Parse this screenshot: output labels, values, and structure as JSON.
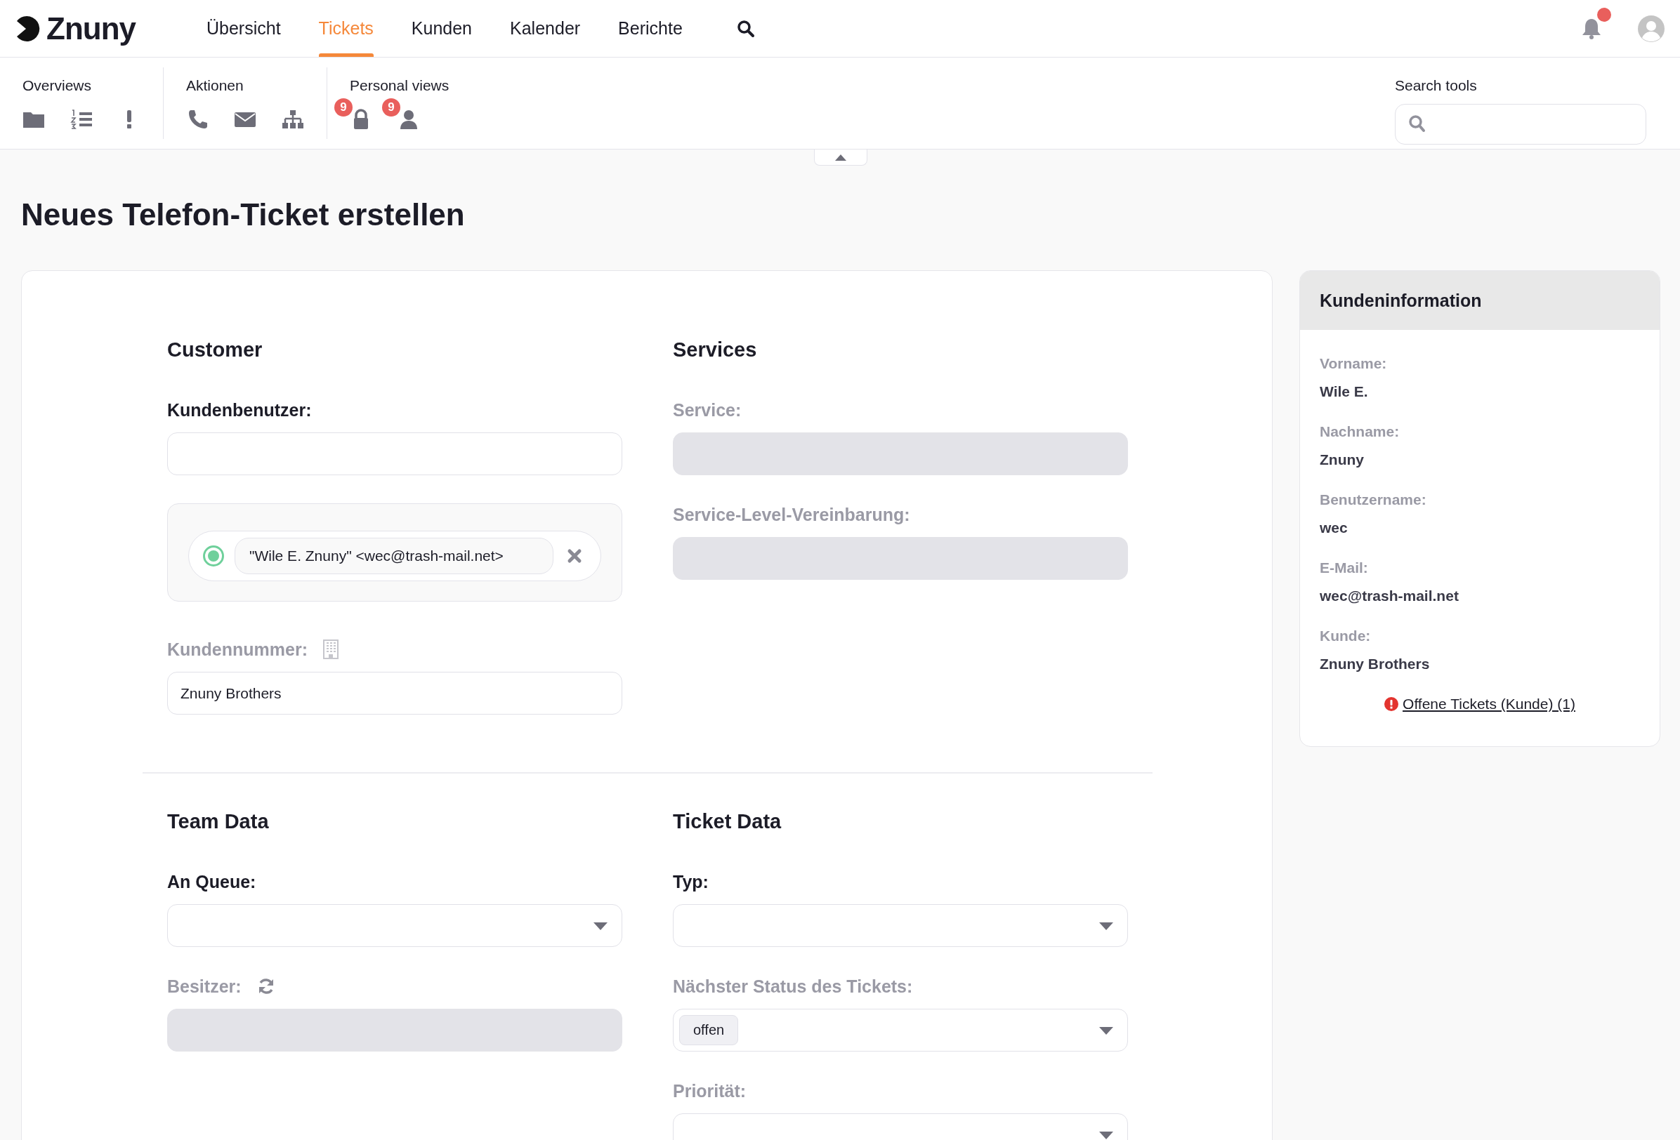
{
  "header": {
    "logo": "Znuny",
    "nav": [
      {
        "label": "Übersicht",
        "selected": false
      },
      {
        "label": "Tickets",
        "selected": true
      },
      {
        "label": "Kunden",
        "selected": false
      },
      {
        "label": "Kalender",
        "selected": false
      },
      {
        "label": "Berichte",
        "selected": false
      }
    ],
    "notifications": {
      "unread": true
    }
  },
  "toolbar": {
    "groups": [
      {
        "label": "Overviews"
      },
      {
        "label": "Aktionen"
      },
      {
        "label": "Personal views",
        "badges": [
          "9",
          "9"
        ]
      }
    ],
    "search_tools": {
      "label": "Search tools"
    }
  },
  "page_title": "Neues Telefon-Ticket erstellen",
  "sections": [
    {
      "title": "Customer",
      "fields": [
        {
          "kind": "text",
          "label": "Kundenbenutzer:",
          "required": true,
          "disabled": false
        },
        {
          "kind": "customer_list",
          "entries": [
            {
              "value": "\"Wile E. Znuny\" <wec@trash-mail.net>",
              "selected": true
            }
          ]
        },
        {
          "kind": "customer_id",
          "label": "Kundennummer:",
          "required": false,
          "disabled": false,
          "value": "Znuny Brothers"
        }
      ]
    },
    {
      "title": "Services",
      "fields": [
        {
          "kind": "text",
          "label": "Service:",
          "required": false,
          "disabled": true
        },
        {
          "kind": "text",
          "label": "Service-Level-Vereinbarung:",
          "required": false,
          "disabled": true
        }
      ]
    },
    {
      "title": "Team Data",
      "fields": [
        {
          "kind": "select",
          "label": "An Queue:",
          "required": true,
          "disabled": false
        },
        {
          "kind": "owner",
          "label": "Besitzer:",
          "required": false,
          "disabled": true
        }
      ]
    },
    {
      "title": "Ticket Data",
      "fields": [
        {
          "kind": "select",
          "label": "Typ:",
          "required": true,
          "disabled": false
        },
        {
          "kind": "select",
          "label": "Nächster Status des Tickets:",
          "required": false,
          "disabled": false,
          "value": "offen"
        },
        {
          "kind": "select",
          "label": "Priorität:",
          "required": false,
          "disabled": false
        }
      ]
    }
  ],
  "customer_info": {
    "title": "Kundeninformation",
    "fields": [
      {
        "label": "Vorname:",
        "value": "Wile E."
      },
      {
        "label": "Nachname:",
        "value": "Znuny"
      },
      {
        "label": "Benutzername:",
        "value": "wec"
      },
      {
        "label": "E-Mail:",
        "value": "wec@trash-mail.net"
      },
      {
        "label": "Kunde:",
        "value": "Znuny Brothers"
      }
    ],
    "link": {
      "text": "Offene Tickets (Kunde) (1)",
      "warning": true
    }
  }
}
